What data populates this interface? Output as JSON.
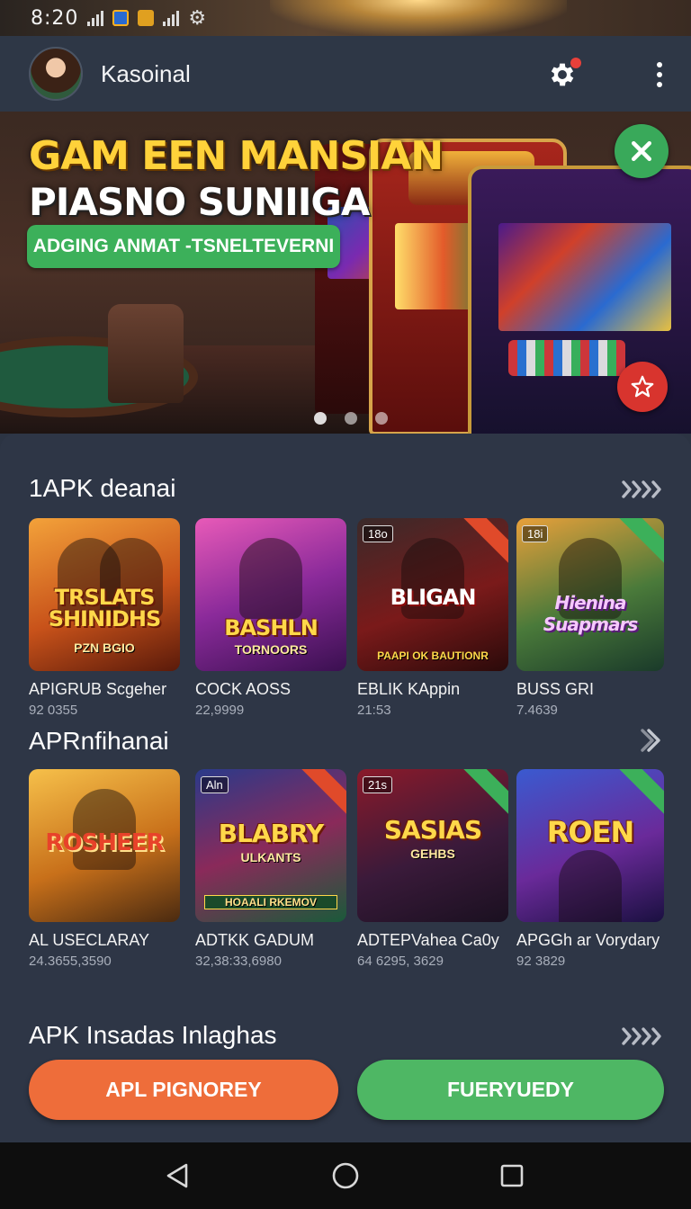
{
  "status_bar": {
    "time": "8:20",
    "icons": [
      "signal-icon",
      "app-icon",
      "sim-icon",
      "signal-icon",
      "settings-gear-icon"
    ]
  },
  "header": {
    "title": "Kasoinal",
    "avatar": "avatar",
    "settings_icon": "gear-icon",
    "menu_icon": "more-vert-icon",
    "notification_dot_color": "#e8403a"
  },
  "banner": {
    "title_line1": "GAM EEN MANSIAN",
    "title_line2": "PIASNO SUNIIGA",
    "pill_label": "ADGING ANMAT -TSNELTEVERNI",
    "close_icon": "close-icon",
    "favorite_icon": "star-icon",
    "page_count": 3,
    "active_page": 1,
    "accent_green": "#3cb05a",
    "accent_red": "#d8342e"
  },
  "sections": [
    {
      "title": "1APK deanai",
      "more_icon": "chevrons-right-icon",
      "cards": [
        {
          "art_title": "TRSLATS SHINIDHS",
          "art_sub": "PZN BGIO",
          "badge": "",
          "name": "APIGRUB Scgeher",
          "meta": "92 0355"
        },
        {
          "art_title": "BASHLN",
          "art_sub": "TORNOORS",
          "badge": "",
          "name": "COCK AOSS",
          "meta": "22,9999"
        },
        {
          "art_title": "BLIGAN",
          "art_sub": "PAAPI OK BAUTIONR",
          "badge": "18o",
          "name": "EBLIK KAppin",
          "meta": "21:53"
        },
        {
          "art_title": "Hienina Suapmars",
          "art_sub": "",
          "badge": "18i",
          "name": "BUSS GRI",
          "meta": "7.4639"
        }
      ]
    },
    {
      "title": "APRnfihanai",
      "more_icon": "chevron-right-icon",
      "cards": [
        {
          "art_title": "ROSHEER",
          "art_sub": "",
          "badge": "",
          "name": "AL USECLARAY",
          "meta": "24.3655,3590"
        },
        {
          "art_title": "BLABRY",
          "art_sub": "ULKANTS",
          "art_sub2": "HOAALI RKEMOV",
          "badge": "Aln",
          "name": "ADTKK GADUM",
          "meta": "32,38:33,6980"
        },
        {
          "art_title": "SASIAS",
          "art_sub": "GEHBS",
          "badge": "21s",
          "name": "ADTEPVahea Ca0y",
          "meta": "64 6295, 3629"
        },
        {
          "art_title": "ROEN",
          "art_sub": "",
          "badge": "",
          "name": "APGGh ar Vorydary",
          "meta": "92 3829"
        }
      ]
    },
    {
      "title": "APK Insadas Inlaghas",
      "more_icon": "chevrons-right-icon"
    }
  ],
  "actions": {
    "primary_label": "APL PIGNOREY",
    "secondary_label": "FUERYUEDY",
    "primary_color": "#ee6d3a",
    "secondary_color": "#4eb764"
  },
  "nav": {
    "back_icon": "back-triangle-icon",
    "home_icon": "home-circle-icon",
    "recents_icon": "recents-square-icon"
  }
}
